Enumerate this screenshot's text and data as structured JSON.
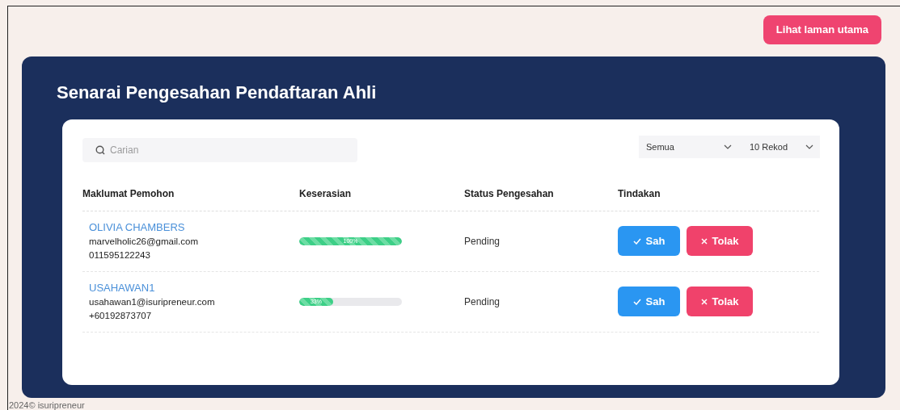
{
  "header": {
    "home_button": "Lihat laman utama"
  },
  "panel": {
    "title": "Senarai Pengesahan Pendaftaran Ahli"
  },
  "search": {
    "placeholder": "Carian"
  },
  "filters": [
    {
      "value": "Semua"
    },
    {
      "value": "10 Rekod"
    }
  ],
  "table": {
    "columns": [
      "Maklumat Pemohon",
      "Keserasian",
      "Status Pengesahan",
      "Tindakan"
    ],
    "rows": [
      {
        "name": "OLIVIA CHAMBERS",
        "email": "marvelholic26@gmail.com",
        "phone": "011595122243",
        "level": 1.0,
        "reading": "100%",
        "status": "Pending",
        "approve": "Sah",
        "reject": "Tolak"
      },
      {
        "name": "USAHAWAN1",
        "email": "usahawan1@isuripreneur.com",
        "phone": "+60192873707",
        "level": 0.33,
        "reading": "33%",
        "status": "Pending",
        "approve": "Sah",
        "reject": "Tolak"
      }
    ]
  },
  "footer": "2024© isuripreneur"
}
